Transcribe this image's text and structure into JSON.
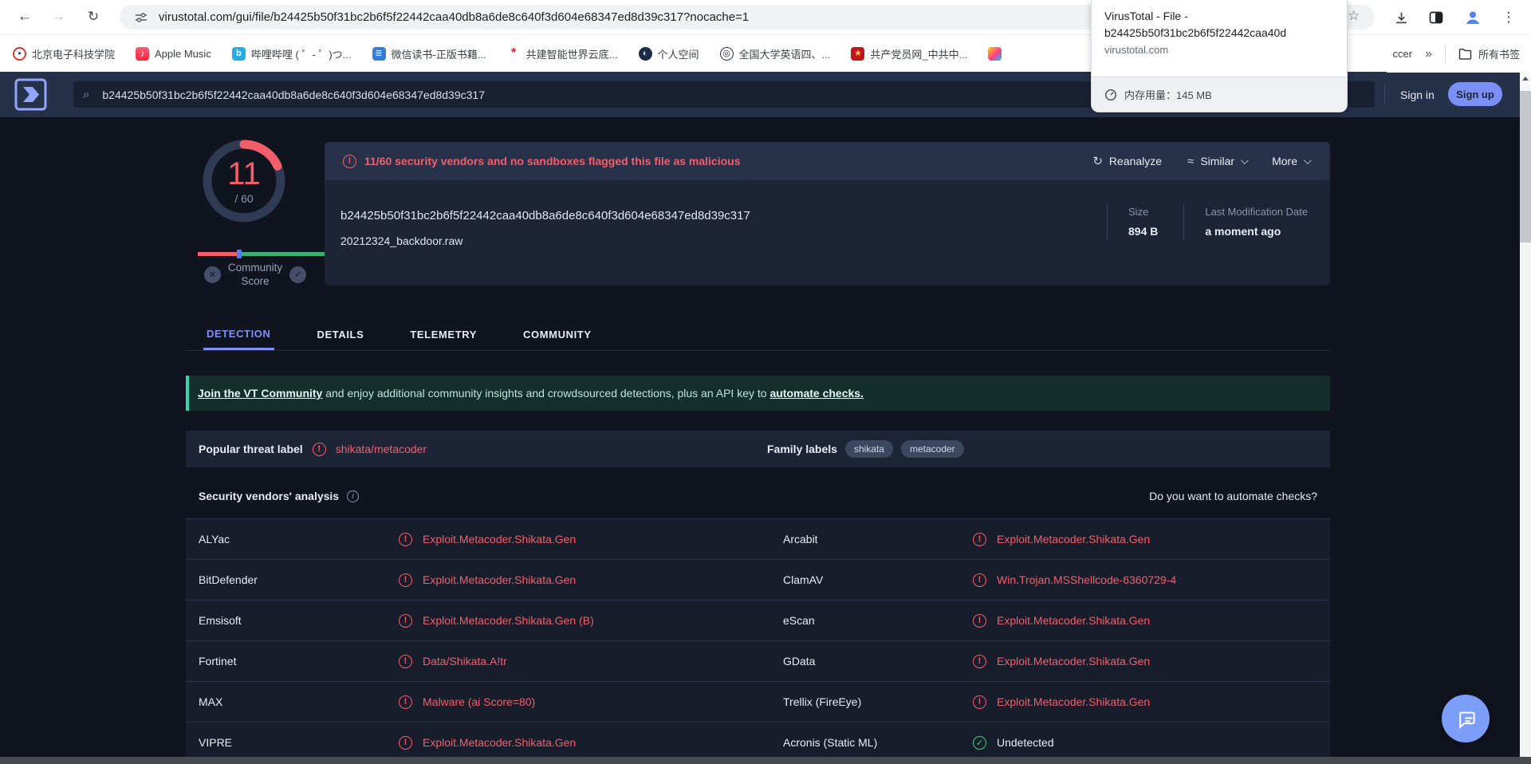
{
  "browser": {
    "toolbar": {
      "url": "virustotal.com/gui/file/b24425b50f31bc2b6f5f22442caa40db8a6de8c640f3d604e68347ed8d39c317?nocache=1"
    },
    "bookmarks": [
      {
        "label": "北京电子科技学院",
        "glyph": "●"
      },
      {
        "label": "Apple Music",
        "glyph": "♪"
      },
      {
        "label": "哔哩哔哩 ( ゜- ゜)つ...",
        "glyph": "b"
      },
      {
        "label": "微信读书-正版书籍...",
        "glyph": "≣"
      },
      {
        "label": "共建智能世界云底...",
        "glyph": "*"
      },
      {
        "label": "个人空间",
        "glyph": "◐"
      },
      {
        "label": "全国大学英语四、...",
        "glyph": "◎"
      },
      {
        "label": "共产党员网_中共中...",
        "glyph": "★"
      },
      {
        "label": "",
        "glyph": ""
      }
    ],
    "overflow": {
      "fragment": "ccer",
      "chevron": "»",
      "all_label": "所有书签"
    },
    "tooltip": {
      "line1": "VirusTotal - File -",
      "line2": "b24425b50f31bc2b6f5f22442caa40d",
      "domain": "virustotal.com",
      "memory": "内存用量：145 MB"
    }
  },
  "vt": {
    "header": {
      "search_value": "b24425b50f31bc2b6f5f22442caa40db8a6de8c640f3d604e68347ed8d39c317",
      "signin": "Sign in",
      "signup": "Sign up"
    },
    "score": {
      "value": "11",
      "denom": "/ 60",
      "community_line1": "Community",
      "community_line2": "Score"
    },
    "alert": {
      "text": "11/60 security vendors and no sandboxes flagged this file as malicious",
      "reanalyze": "Reanalyze",
      "similar": "Similar",
      "more": "More"
    },
    "file": {
      "hash": "b24425b50f31bc2b6f5f22442caa40db8a6de8c640f3d604e68347ed8d39c317",
      "name": "20212324_backdoor.raw",
      "size_label": "Size",
      "size_value": "894 B",
      "mod_label": "Last Modification Date",
      "mod_value": "a moment ago"
    },
    "tabs": [
      "DETECTION",
      "DETAILS",
      "TELEMETRY",
      "COMMUNITY"
    ],
    "banner": {
      "link1": "Join the VT Community",
      "mid": " and enjoy additional community insights and crowdsourced detections, plus an API key to ",
      "link2": "automate checks."
    },
    "threat": {
      "label": "Popular threat label",
      "value": "shikata/metacoder",
      "family_label": "Family labels",
      "families": [
        "shikata",
        "metacoder"
      ]
    },
    "analysis": {
      "title": "Security vendors' analysis",
      "automate": "Do you want to automate checks?"
    },
    "vendors": [
      {
        "name": "ALYac",
        "result": "Exploit.Metacoder.Shikata.Gen"
      },
      {
        "name": "Arcabit",
        "result": "Exploit.Metacoder.Shikata.Gen"
      },
      {
        "name": "BitDefender",
        "result": "Exploit.Metacoder.Shikata.Gen"
      },
      {
        "name": "ClamAV",
        "result": "Win.Trojan.MSShellcode-6360729-4"
      },
      {
        "name": "Emsisoft",
        "result": "Exploit.Metacoder.Shikata.Gen (B)"
      },
      {
        "name": "eScan",
        "result": "Exploit.Metacoder.Shikata.Gen"
      },
      {
        "name": "Fortinet",
        "result": "Data/Shikata.A!tr"
      },
      {
        "name": "GData",
        "result": "Exploit.Metacoder.Shikata.Gen"
      },
      {
        "name": "MAX",
        "result": "Malware (ai Score=80)"
      },
      {
        "name": "Trellix (FireEye)",
        "result": "Exploit.Metacoder.Shikata.Gen"
      },
      {
        "name": "VIPRE",
        "result": "Exploit.Metacoder.Shikata.Gen"
      },
      {
        "name": "Acronis (Static ML)",
        "result": "Undetected"
      }
    ]
  },
  "icons": {
    "back": "←",
    "forward": "→",
    "reload": "↻",
    "star": "☆",
    "menu": "⋮",
    "search": "⌕",
    "warning": "!",
    "check": "✓",
    "cross": "✕",
    "info": "i",
    "approx": "≈"
  },
  "colors": {
    "accent_blue": "#7e90fa",
    "malicious_red": "#f25f6b",
    "undetected_green": "#42cd87",
    "community_green": "#3fae71",
    "teal_accent": "#2fd7ac",
    "header_bg": "#253049",
    "page_bg": "#10141f",
    "card_bg": "#1c2436",
    "signup_pill": "#7b90f7"
  }
}
